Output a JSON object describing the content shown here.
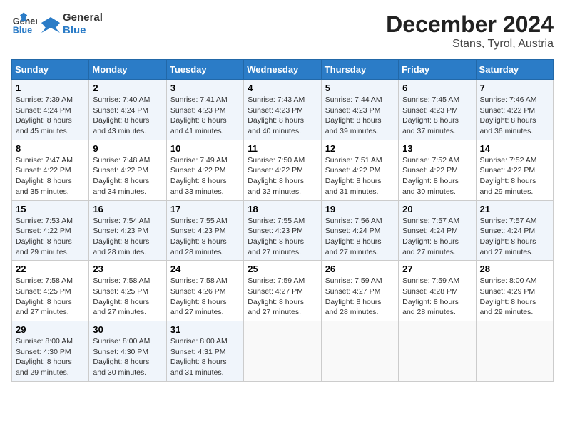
{
  "header": {
    "logo_line1": "General",
    "logo_line2": "Blue",
    "month": "December 2024",
    "location": "Stans, Tyrol, Austria"
  },
  "weekdays": [
    "Sunday",
    "Monday",
    "Tuesday",
    "Wednesday",
    "Thursday",
    "Friday",
    "Saturday"
  ],
  "weeks": [
    [
      {
        "day": "1",
        "sunrise": "7:39 AM",
        "sunset": "4:24 PM",
        "daylight": "8 hours and 45 minutes."
      },
      {
        "day": "2",
        "sunrise": "7:40 AM",
        "sunset": "4:24 PM",
        "daylight": "8 hours and 43 minutes."
      },
      {
        "day": "3",
        "sunrise": "7:41 AM",
        "sunset": "4:23 PM",
        "daylight": "8 hours and 41 minutes."
      },
      {
        "day": "4",
        "sunrise": "7:43 AM",
        "sunset": "4:23 PM",
        "daylight": "8 hours and 40 minutes."
      },
      {
        "day": "5",
        "sunrise": "7:44 AM",
        "sunset": "4:23 PM",
        "daylight": "8 hours and 39 minutes."
      },
      {
        "day": "6",
        "sunrise": "7:45 AM",
        "sunset": "4:23 PM",
        "daylight": "8 hours and 37 minutes."
      },
      {
        "day": "7",
        "sunrise": "7:46 AM",
        "sunset": "4:22 PM",
        "daylight": "8 hours and 36 minutes."
      }
    ],
    [
      {
        "day": "8",
        "sunrise": "7:47 AM",
        "sunset": "4:22 PM",
        "daylight": "8 hours and 35 minutes."
      },
      {
        "day": "9",
        "sunrise": "7:48 AM",
        "sunset": "4:22 PM",
        "daylight": "8 hours and 34 minutes."
      },
      {
        "day": "10",
        "sunrise": "7:49 AM",
        "sunset": "4:22 PM",
        "daylight": "8 hours and 33 minutes."
      },
      {
        "day": "11",
        "sunrise": "7:50 AM",
        "sunset": "4:22 PM",
        "daylight": "8 hours and 32 minutes."
      },
      {
        "day": "12",
        "sunrise": "7:51 AM",
        "sunset": "4:22 PM",
        "daylight": "8 hours and 31 minutes."
      },
      {
        "day": "13",
        "sunrise": "7:52 AM",
        "sunset": "4:22 PM",
        "daylight": "8 hours and 30 minutes."
      },
      {
        "day": "14",
        "sunrise": "7:52 AM",
        "sunset": "4:22 PM",
        "daylight": "8 hours and 29 minutes."
      }
    ],
    [
      {
        "day": "15",
        "sunrise": "7:53 AM",
        "sunset": "4:22 PM",
        "daylight": "8 hours and 29 minutes."
      },
      {
        "day": "16",
        "sunrise": "7:54 AM",
        "sunset": "4:23 PM",
        "daylight": "8 hours and 28 minutes."
      },
      {
        "day": "17",
        "sunrise": "7:55 AM",
        "sunset": "4:23 PM",
        "daylight": "8 hours and 28 minutes."
      },
      {
        "day": "18",
        "sunrise": "7:55 AM",
        "sunset": "4:23 PM",
        "daylight": "8 hours and 27 minutes."
      },
      {
        "day": "19",
        "sunrise": "7:56 AM",
        "sunset": "4:24 PM",
        "daylight": "8 hours and 27 minutes."
      },
      {
        "day": "20",
        "sunrise": "7:57 AM",
        "sunset": "4:24 PM",
        "daylight": "8 hours and 27 minutes."
      },
      {
        "day": "21",
        "sunrise": "7:57 AM",
        "sunset": "4:24 PM",
        "daylight": "8 hours and 27 minutes."
      }
    ],
    [
      {
        "day": "22",
        "sunrise": "7:58 AM",
        "sunset": "4:25 PM",
        "daylight": "8 hours and 27 minutes."
      },
      {
        "day": "23",
        "sunrise": "7:58 AM",
        "sunset": "4:25 PM",
        "daylight": "8 hours and 27 minutes."
      },
      {
        "day": "24",
        "sunrise": "7:58 AM",
        "sunset": "4:26 PM",
        "daylight": "8 hours and 27 minutes."
      },
      {
        "day": "25",
        "sunrise": "7:59 AM",
        "sunset": "4:27 PM",
        "daylight": "8 hours and 27 minutes."
      },
      {
        "day": "26",
        "sunrise": "7:59 AM",
        "sunset": "4:27 PM",
        "daylight": "8 hours and 28 minutes."
      },
      {
        "day": "27",
        "sunrise": "7:59 AM",
        "sunset": "4:28 PM",
        "daylight": "8 hours and 28 minutes."
      },
      {
        "day": "28",
        "sunrise": "8:00 AM",
        "sunset": "4:29 PM",
        "daylight": "8 hours and 29 minutes."
      }
    ],
    [
      {
        "day": "29",
        "sunrise": "8:00 AM",
        "sunset": "4:30 PM",
        "daylight": "8 hours and 29 minutes."
      },
      {
        "day": "30",
        "sunrise": "8:00 AM",
        "sunset": "4:30 PM",
        "daylight": "8 hours and 30 minutes."
      },
      {
        "day": "31",
        "sunrise": "8:00 AM",
        "sunset": "4:31 PM",
        "daylight": "8 hours and 31 minutes."
      },
      null,
      null,
      null,
      null
    ]
  ]
}
